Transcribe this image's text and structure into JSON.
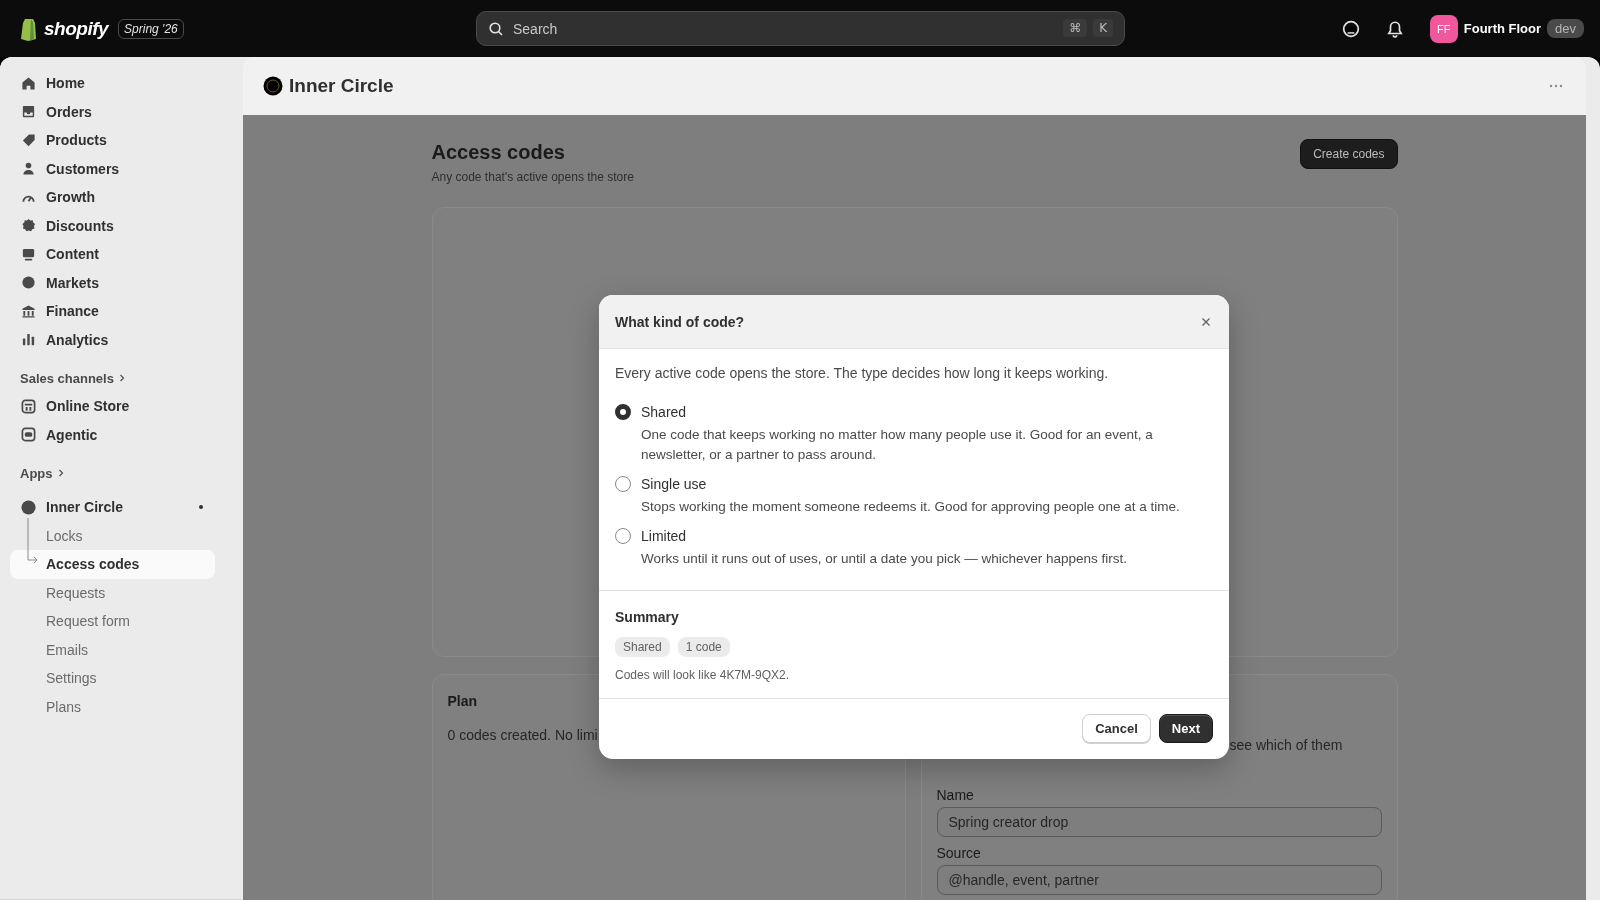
{
  "top_bar": {
    "logo_text": "shopify",
    "edition": "Spring '26",
    "search": {
      "placeholder": "Search",
      "shortcut": [
        "⌘",
        "K"
      ]
    },
    "account": {
      "initials": "FF",
      "name": "Fourth Floor",
      "badge": "dev"
    }
  },
  "sidebar": {
    "main_items": [
      {
        "label": "Home",
        "selected": false
      },
      {
        "label": "Orders",
        "selected": false
      },
      {
        "label": "Products",
        "selected": false
      },
      {
        "label": "Customers",
        "selected": false
      },
      {
        "label": "Growth",
        "selected": false
      },
      {
        "label": "Discounts",
        "selected": false
      },
      {
        "label": "Content",
        "selected": false
      },
      {
        "label": "Markets",
        "selected": false
      },
      {
        "label": "Finance",
        "selected": false
      },
      {
        "label": "Analytics",
        "selected": false
      }
    ],
    "sales_channels": {
      "heading": "Sales channels",
      "items": [
        {
          "label": "Online Store",
          "selected": false
        },
        {
          "label": "Agentic",
          "selected": false
        }
      ]
    },
    "apps": {
      "heading": "Apps",
      "app": {
        "label": "Inner Circle",
        "children": [
          {
            "label": "Locks",
            "selected": false
          },
          {
            "label": "Access codes",
            "selected": true
          },
          {
            "label": "Requests",
            "selected": false
          },
          {
            "label": "Request form",
            "selected": false
          },
          {
            "label": "Emails",
            "selected": false
          },
          {
            "label": "Settings",
            "selected": false
          },
          {
            "label": "Plans",
            "selected": false
          }
        ]
      }
    }
  },
  "page": {
    "app_title": "Inner Circle",
    "title": "Access codes",
    "subtitle": "Any code that's active opens the store",
    "primary_action": "Create codes",
    "plan_card": {
      "title": "Plan",
      "text": "0 codes created. No limi"
    },
    "side_card": {
      "text": "see which of them",
      "fields": [
        {
          "label": "Name",
          "value": "Spring creator drop"
        },
        {
          "label": "Source",
          "placeholder": "@handle, event, partner"
        }
      ]
    }
  },
  "dialog": {
    "title": "What kind of code?",
    "intro": "Every active code opens the store. The type decides how long it keeps working.",
    "options": [
      {
        "label": "Shared",
        "description": "One code that keeps working no matter how many people use it. Good for an event, a newsletter, or a partner to pass around.",
        "selected": true
      },
      {
        "label": "Single use",
        "description": "Stops working the moment someone redeems it. Good for approving people one at a time.",
        "selected": false
      },
      {
        "label": "Limited",
        "description": "Works until it runs out of uses, or until a date you pick — whichever happens first.",
        "selected": false
      }
    ],
    "summary": {
      "heading": "Summary",
      "tags": [
        "Shared",
        "1 code"
      ],
      "note": "Codes will look like 4K7M-9QX2."
    },
    "buttons": [
      {
        "label": "Cancel",
        "kind": "secondary"
      },
      {
        "label": "Next",
        "kind": "primary"
      }
    ]
  }
}
